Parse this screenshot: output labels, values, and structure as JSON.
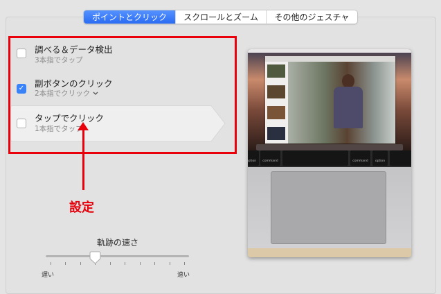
{
  "tabs": [
    {
      "label": "ポイントとクリック",
      "active": true
    },
    {
      "label": "スクロールとズーム",
      "active": false
    },
    {
      "label": "その他のジェスチャ",
      "active": false
    }
  ],
  "options": [
    {
      "title": "調べる＆データ検出",
      "subtitle": "3本指でタップ",
      "checked": false
    },
    {
      "title": "副ボタンのクリック",
      "subtitle": "2本指でクリック",
      "checked": true,
      "has_dropdown": true
    },
    {
      "title": "タップでクリック",
      "subtitle": "1本指でタップ",
      "checked": false,
      "highlighted": true
    }
  ],
  "annotation": {
    "label": "設定",
    "color": "#e8000b"
  },
  "slider": {
    "label": "軌跡の速さ",
    "min_label": "遅い",
    "max_label": "速い",
    "ticks": 10,
    "value": 0.333
  },
  "preview": {
    "keys": {
      "option": "option",
      "command": "command",
      "cmd_symbol": "⌘",
      "opt_symbol": "⌥"
    }
  },
  "colors": {
    "accent": "#2a6cf3",
    "annotation": "#e8000b"
  }
}
